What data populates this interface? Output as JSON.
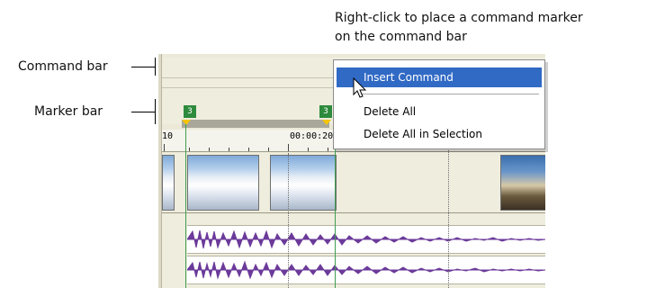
{
  "annotations": {
    "top_caption": "Right-click to place a command marker on the command bar",
    "top_caption_line1": "Right-click to place a command marker",
    "top_caption_line2": "on the command bar",
    "command_bar_label": "Command bar",
    "marker_bar_label": "Marker bar"
  },
  "markers": [
    {
      "label": "3"
    },
    {
      "label": "3"
    }
  ],
  "ruler": {
    "labels": [
      "10",
      "00:00:20"
    ]
  },
  "context_menu": {
    "items": [
      {
        "label": "Insert Command",
        "highlighted": true
      },
      {
        "label": "Delete All",
        "highlighted": false
      },
      {
        "label": "Delete All in Selection",
        "highlighted": false
      }
    ]
  },
  "colors": {
    "menu_highlight": "#316ac5",
    "marker_green": "#2e8b3d",
    "waveform": "#6b3a9a",
    "selection_line": "#3f9e52"
  },
  "icons": {
    "pointer": "arrow-cursor-icon"
  }
}
